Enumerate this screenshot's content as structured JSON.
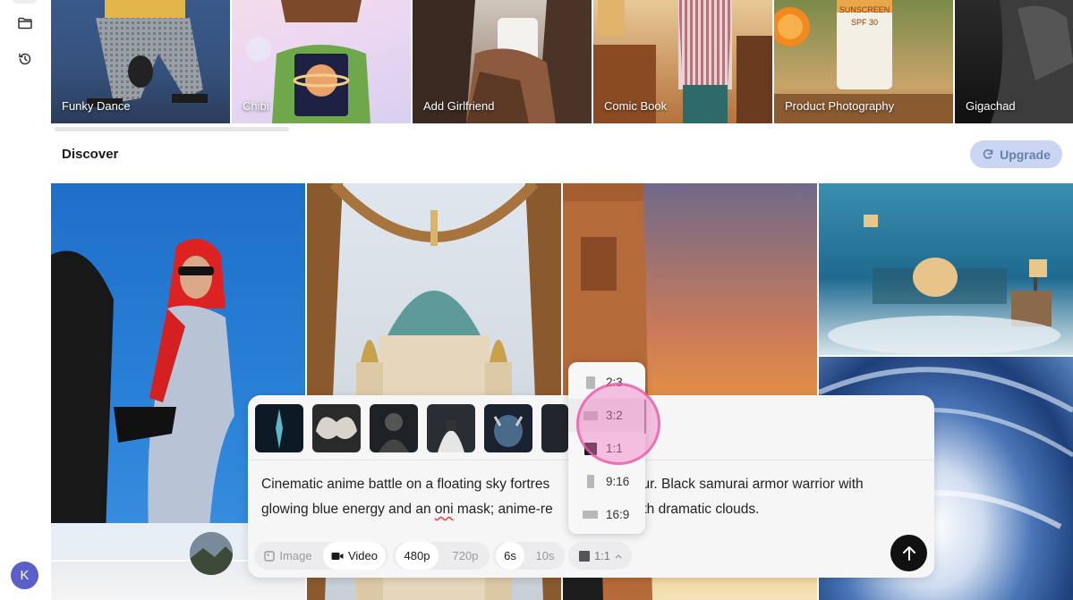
{
  "sidebar": {
    "icons": [
      "folder-icon",
      "history-icon"
    ],
    "avatar_letter": "K"
  },
  "styles": [
    {
      "label": "Funky Dance"
    },
    {
      "label": "Chibi"
    },
    {
      "label": "Add Girlfriend"
    },
    {
      "label": "Comic Book"
    },
    {
      "label": "Product Photography"
    },
    {
      "label": "Gigachad"
    }
  ],
  "discover": {
    "title": "Discover",
    "upgrade_label": "Upgrade"
  },
  "composer": {
    "prompt_before": "Cinematic anime battle on a floating sky fortres",
    "prompt_mid": "hour. Black samurai armor warrior with",
    "prompt_line2_a": "glowing blue energy and an ",
    "prompt_underlined": "oni",
    "prompt_line2_b": " mask; anime-re",
    "prompt_line2_c": "with dramatic clouds.",
    "mode_image": "Image",
    "mode_video": "Video",
    "res_480": "480p",
    "res_720": "720p",
    "dur_6": "6s",
    "dur_10": "10s",
    "ratio_current": "1:1"
  },
  "ratio_menu": {
    "items": [
      "2:3",
      "3:2",
      "1:1",
      "9:16",
      "16:9"
    ],
    "selected": "1:1"
  },
  "colors": {
    "accent": "#5b5fc7",
    "upgrade_bg": "#c9d5f3",
    "touch": "#f078be"
  }
}
